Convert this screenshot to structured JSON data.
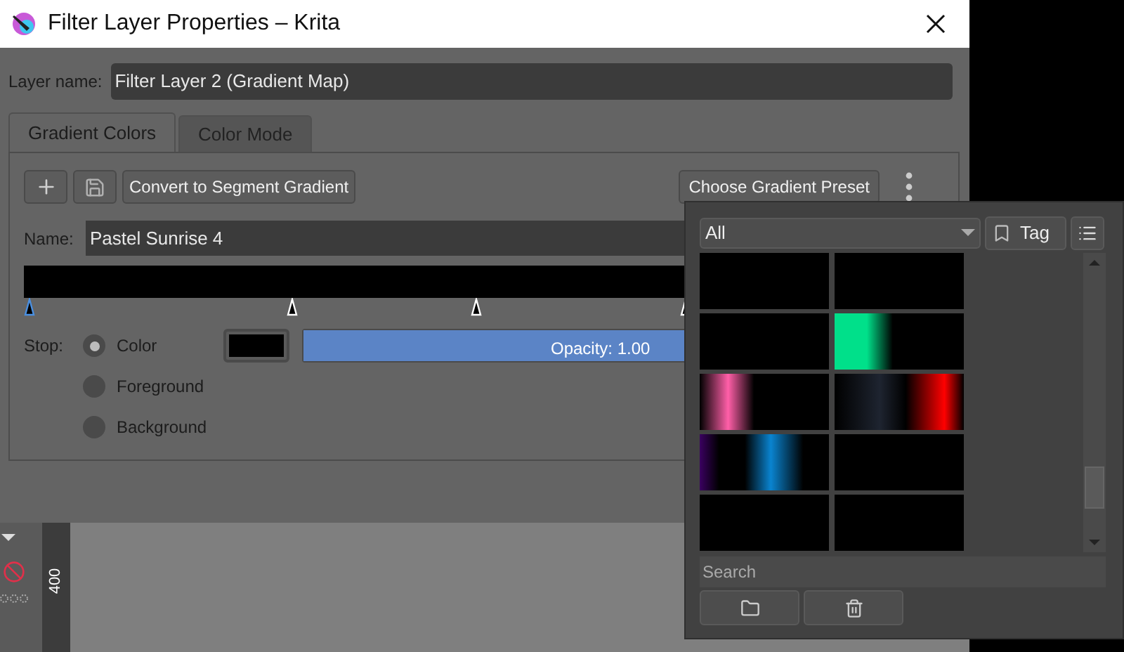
{
  "window": {
    "title": "Filter Layer Properties – Krita"
  },
  "layer_name": {
    "label": "Layer name:",
    "value": "Filter Layer 2 (Gradient Map)"
  },
  "tabs": [
    {
      "label": "Gradient Colors",
      "selected": true
    },
    {
      "label": "Color Mode",
      "selected": false
    }
  ],
  "toolbar": {
    "convert_button": "Convert to Segment Gradient",
    "preset_button": "Choose Gradient Preset"
  },
  "name": {
    "label": "Name:",
    "value": "Pastel Sunrise 4"
  },
  "stops": [
    {
      "selected": true
    },
    {
      "selected": false
    },
    {
      "selected": false
    },
    {
      "selected": false
    }
  ],
  "stop": {
    "label": "Stop:",
    "options": [
      {
        "label": "Color",
        "selected": true
      },
      {
        "label": "Foreground",
        "selected": false
      },
      {
        "label": "Background",
        "selected": false
      }
    ],
    "opacity": "Opacity: 1.00",
    "level": 1
  },
  "ruler": {
    "label": "400"
  },
  "preset_popup": {
    "filter": "All",
    "tag_button": "Tag",
    "search_placeholder": "Search",
    "presets": [
      {
        "color": "#000000"
      },
      {
        "color": "#000000"
      },
      {
        "color": "#000000"
      },
      {
        "color": "#00e08a"
      },
      {
        "color": "#ff5fa8"
      },
      {
        "color": "#ff0000"
      },
      {
        "color": "#0a84d0"
      },
      {
        "color": "#000000"
      },
      {
        "color": "#000000"
      },
      {
        "color": "#000000"
      }
    ]
  }
}
